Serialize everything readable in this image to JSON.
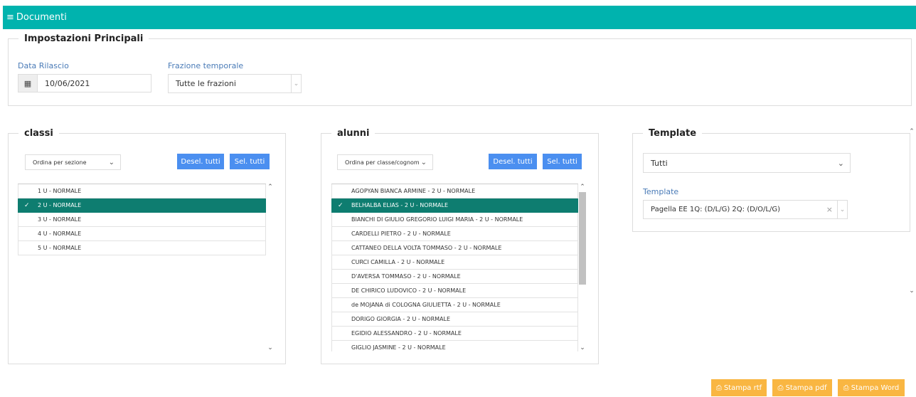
{
  "header": {
    "title": "Documenti",
    "menu_icon": "list-icon"
  },
  "settings": {
    "legend": "Impostazioni Principali",
    "date_label": "Data Rilascio",
    "date_value": "10/06/2021",
    "period_label": "Frazione temporale",
    "period_value": "Tutte le frazioni"
  },
  "classi": {
    "legend": "classi",
    "sort_value": "Ordina per sezione",
    "deselect_label": "Desel. tutti",
    "select_label": "Sel. tutti",
    "items": [
      {
        "label": "1 U - NORMALE",
        "selected": false
      },
      {
        "label": "2 U - NORMALE",
        "selected": true
      },
      {
        "label": "3 U - NORMALE",
        "selected": false
      },
      {
        "label": "4 U - NORMALE",
        "selected": false
      },
      {
        "label": "5 U - NORMALE",
        "selected": false
      }
    ]
  },
  "alunni": {
    "legend": "alunni",
    "sort_value": "Ordina per classe/cognom",
    "deselect_label": "Desel. tutti",
    "select_label": "Sel. tutti",
    "items": [
      {
        "label": "AGOPYAN BIANCA ARMINE - 2 U - NORMALE",
        "selected": false
      },
      {
        "label": "BELHALBA ELIAS - 2 U - NORMALE",
        "selected": true
      },
      {
        "label": "BIANCHI DI GIULIO GREGORIO LUIGI MARIA - 2 U - NORMALE",
        "selected": false
      },
      {
        "label": "CARDELLI PIETRO - 2 U - NORMALE",
        "selected": false
      },
      {
        "label": "CATTANEO DELLA VOLTA TOMMASO - 2 U - NORMALE",
        "selected": false
      },
      {
        "label": "CURCI CAMILLA - 2 U - NORMALE",
        "selected": false
      },
      {
        "label": "D'AVERSA TOMMASO - 2 U - NORMALE",
        "selected": false
      },
      {
        "label": "DE CHIRICO LUDOVICO - 2 U - NORMALE",
        "selected": false
      },
      {
        "label": "de MOJANA di COLOGNA GIULIETTA - 2 U - NORMALE",
        "selected": false
      },
      {
        "label": "DORIGO GIORGIA - 2 U - NORMALE",
        "selected": false
      },
      {
        "label": "EGIDIO ALESSANDRO - 2 U - NORMALE",
        "selected": false
      },
      {
        "label": "GIGLIO JASMINE - 2 U - NORMALE",
        "selected": false
      }
    ]
  },
  "template": {
    "legend": "Template",
    "filter_value": "Tutti",
    "template_label": "Template",
    "template_value": "Pagella EE 1Q: (D/L/G) 2Q: (D/O/L/G)"
  },
  "print": {
    "rtf_label": "Stampa rtf",
    "pdf_label": "Stampa pdf",
    "word_label": "Stampa Word"
  },
  "colors": {
    "header": "#00B3AE",
    "selected_row": "#0E7D70",
    "primary_button": "#4B8FF0",
    "print_button": "#F9B642",
    "label": "#4A7BB7"
  }
}
